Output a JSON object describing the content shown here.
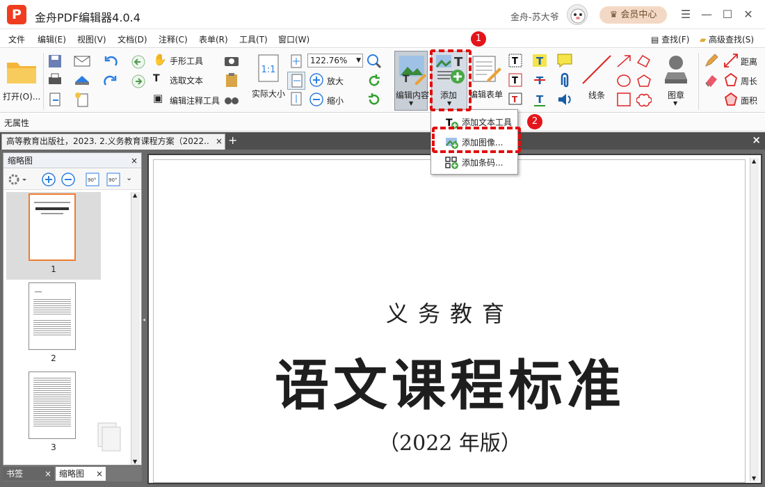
{
  "app": {
    "title": "金舟PDF编辑器4.0.4",
    "logo_letter": "P",
    "username": "金舟-苏大爷",
    "vip_label": "会员中心"
  },
  "menu": [
    "文件",
    "编辑(E)",
    "视图(V)",
    "文档(D)",
    "注释(C)",
    "表单(R)",
    "工具(T)",
    "窗口(W)"
  ],
  "menu_right": {
    "find": "查找(F)",
    "advanced_find": "高级查找(S)"
  },
  "toolbar": {
    "open": "打开(O)...",
    "hand_tool": "手形工具",
    "select_text": "选取文本",
    "edit_annotation": "编辑注释工具",
    "actual_size": "实际大小",
    "zoom_value": "122.76%",
    "zoom_in": "放大",
    "zoom_out": "缩小",
    "edit_content": "编辑内容",
    "add": "添加",
    "edit_form": "编辑表单",
    "lines": "线条",
    "stamp": "图章",
    "distance": "距离",
    "perimeter": "周长",
    "area": "面积"
  },
  "properties": {
    "label": "无属性"
  },
  "tabs": {
    "doc_tab": "高等教育出版社，2023. 2.义务教育课程方案（2022..",
    "close": "×",
    "add": "+",
    "close_all": "×"
  },
  "thumbnail_panel": {
    "title": "缩略图",
    "close": "×",
    "pages": [
      "1",
      "2",
      "3"
    ]
  },
  "bottom_tabs": {
    "bookmarks": "书签",
    "thumbnails": "缩略图",
    "close": "×"
  },
  "document": {
    "subtitle": "义务教育",
    "title": "语文课程标准",
    "edition": "（2022 年版）"
  },
  "add_menu": [
    "添加文本工具",
    "添加图像...",
    "添加条码..."
  ],
  "annotations": {
    "step1": "1",
    "step2": "2"
  },
  "colors": {
    "accent_red": "#e10e0e",
    "logo": "#ef3c1f",
    "workspace": "#6a6a6a"
  }
}
